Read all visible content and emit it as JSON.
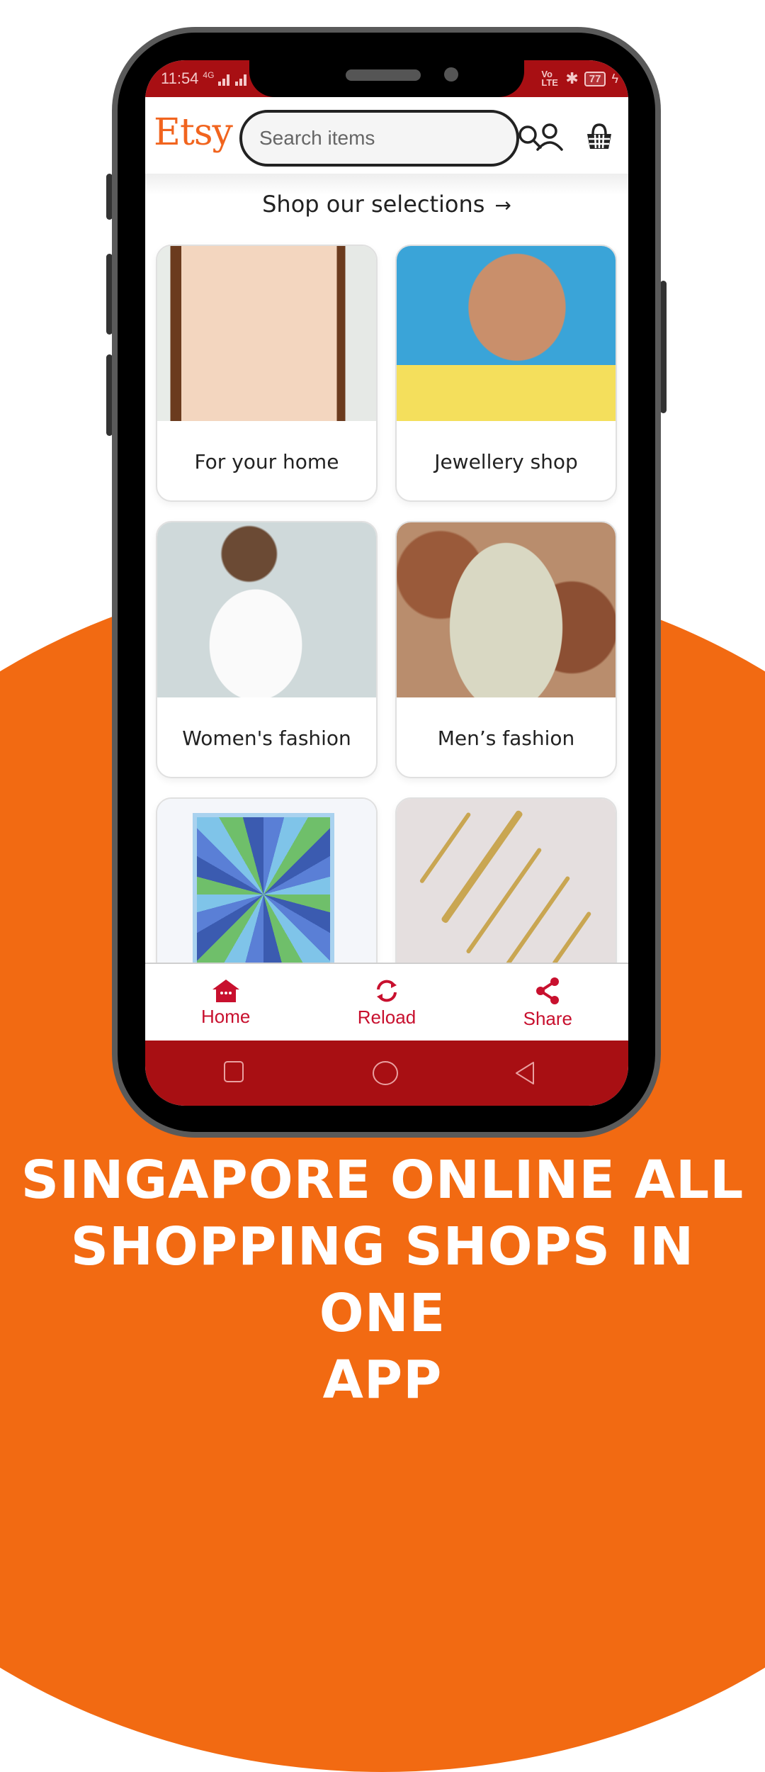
{
  "colors": {
    "accent_orange": "#F26A12",
    "etsy_orange": "#F1641E",
    "status_bar_red": "#A80F13",
    "nav_red": "#C8102E"
  },
  "status_bar": {
    "time": "11:54",
    "network": "4G",
    "volte": "Vo LTE",
    "battery": "77"
  },
  "header": {
    "logo": "Etsy",
    "search_placeholder": "Search items",
    "icons": [
      "search-icon",
      "account-icon",
      "basket-icon"
    ]
  },
  "section": {
    "title": "Shop our selections",
    "arrow": "→"
  },
  "cards": [
    {
      "label": "For your home",
      "image": "quilted wall hanging"
    },
    {
      "label": "Jewellery shop",
      "image": "woman wearing jhumka earrings and necklace"
    },
    {
      "label": "Women's fashion",
      "image": "woman in white t-shirt and sunglasses"
    },
    {
      "label": "Men’s fashion",
      "image": "man in beige kurta"
    },
    {
      "label": "",
      "image": "geometric blue paper art"
    },
    {
      "label": "",
      "image": "gold cutlery set"
    }
  ],
  "bottom_nav": {
    "items": [
      {
        "label": "Home",
        "icon": "home-icon"
      },
      {
        "label": "Reload",
        "icon": "reload-icon"
      },
      {
        "label": "Share",
        "icon": "share-icon"
      }
    ]
  },
  "android_nav": [
    "recents-button",
    "home-button",
    "back-button"
  ],
  "promo": {
    "headline_lines": [
      "SINGAPORE ONLINE ALL",
      "SHOPPING SHOPS IN ONE",
      "APP"
    ]
  }
}
